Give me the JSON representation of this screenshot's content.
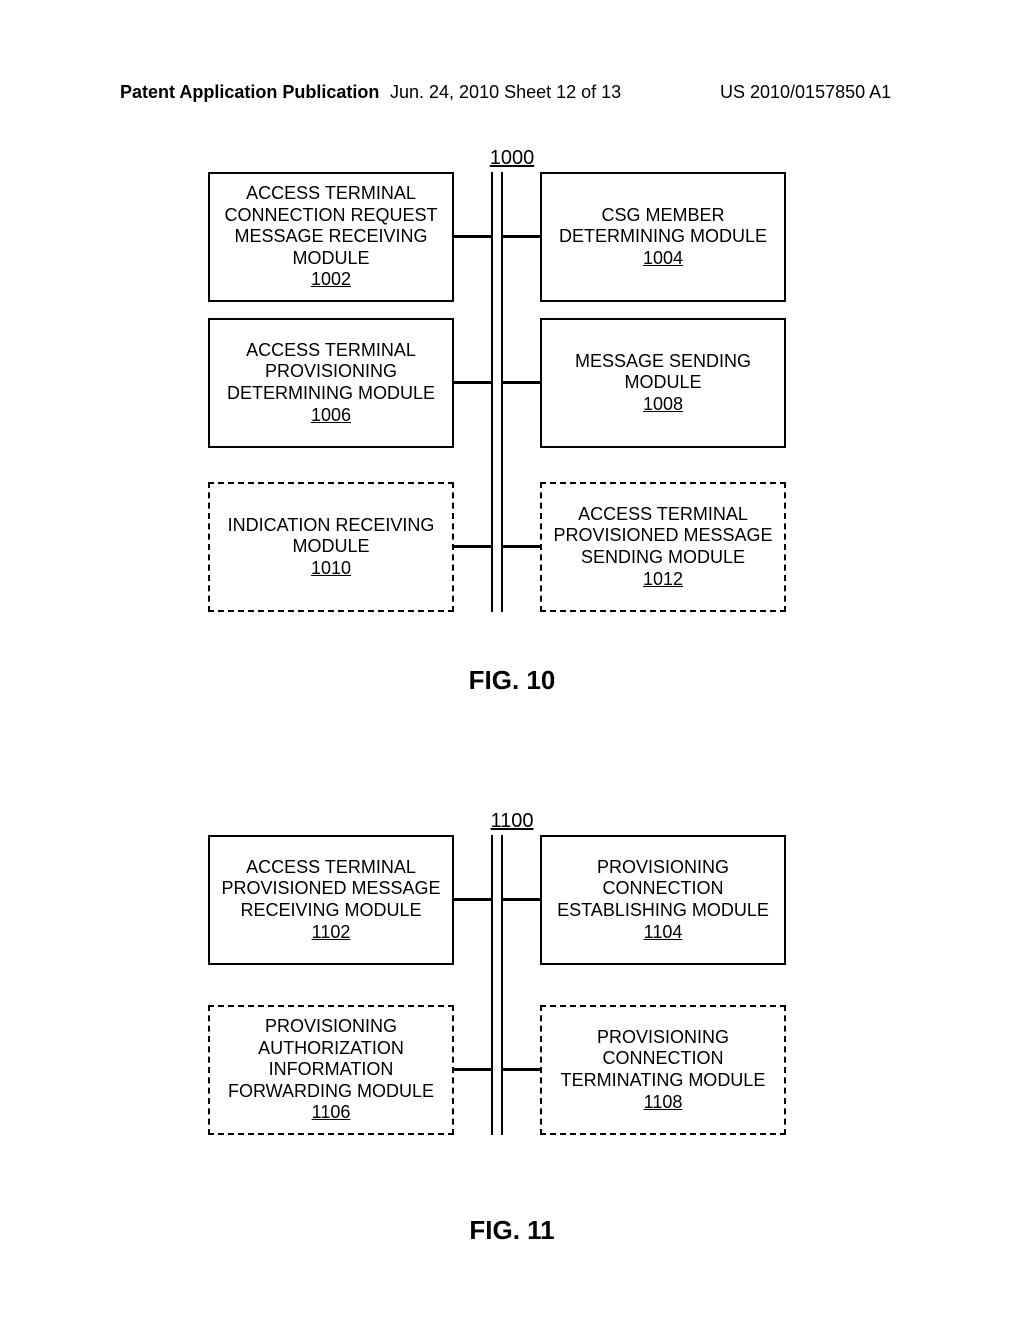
{
  "header": {
    "left": "Patent Application Publication",
    "mid": "Jun. 24, 2010  Sheet 12 of 13",
    "right": "US 2010/0157850 A1"
  },
  "fig10": {
    "top_label": "1000",
    "caption": "FIG. 10",
    "boxes": {
      "b1002": {
        "text": "ACCESS TERMINAL CONNECTION REQUEST MESSAGE RECEIVING MODULE",
        "ref": "1002"
      },
      "b1004": {
        "text": "CSG MEMBER DETERMINING MODULE",
        "ref": "1004"
      },
      "b1006": {
        "text": "ACCESS TERMINAL PROVISIONING DETERMINING MODULE",
        "ref": "1006"
      },
      "b1008": {
        "text": "MESSAGE SENDING MODULE",
        "ref": "1008"
      },
      "b1010": {
        "text": "INDICATION RECEIVING MODULE",
        "ref": "1010"
      },
      "b1012": {
        "text": "ACCESS TERMINAL PROVISIONED MESSAGE SENDING MODULE",
        "ref": "1012"
      }
    }
  },
  "fig11": {
    "top_label": "1100",
    "caption": "FIG. 11",
    "boxes": {
      "b1102": {
        "text": "ACCESS TERMINAL PROVISIONED MESSAGE RECEIVING MODULE",
        "ref": "1102"
      },
      "b1104": {
        "text": "PROVISIONING CONNECTION ESTABLISHING MODULE",
        "ref": "1104"
      },
      "b1106": {
        "text": "PROVISIONING AUTHORIZATION INFORMATION FORWARDING MODULE",
        "ref": "1106"
      },
      "b1108": {
        "text": "PROVISIONING CONNECTION TERMINATING MODULE",
        "ref": "1108"
      }
    }
  }
}
